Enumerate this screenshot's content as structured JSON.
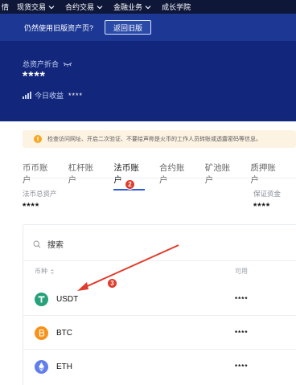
{
  "topnav": {
    "items": [
      {
        "label": "情",
        "has_chevron": false
      },
      {
        "label": "现货交易",
        "has_chevron": true
      },
      {
        "label": "合约交易",
        "has_chevron": true
      },
      {
        "label": "金融业务",
        "has_chevron": true
      },
      {
        "label": "成长学院",
        "has_chevron": false
      }
    ]
  },
  "old_bar": {
    "question": "仍然使用旧版资产页?",
    "button_label": "返回旧版"
  },
  "summary": {
    "total_label": "总资产折合",
    "total_value": "****",
    "today_label": "今日收益",
    "today_value": "****"
  },
  "notice": {
    "text": "检查访问网址、开启二次验证、不要给声称是火币的工作人员转账或透露密码等信息。"
  },
  "tabs": [
    {
      "label": "币币账户",
      "active": false
    },
    {
      "label": "杠杆账户",
      "active": false
    },
    {
      "label": "法币账户",
      "active": true
    },
    {
      "label": "合约账户",
      "active": false
    },
    {
      "label": "矿池账户",
      "active": false
    },
    {
      "label": "质押账户",
      "active": false
    }
  ],
  "fiat": {
    "label": "法币总资产",
    "value": "****",
    "margin_label": "保证资金",
    "margin_value": "****"
  },
  "search": {
    "placeholder": "搜索"
  },
  "table": {
    "col_currency": "币种",
    "col_available": "可用",
    "rows": [
      {
        "symbol": "USDT",
        "available": "****",
        "icon": "tether-icon",
        "color": "#26a17b"
      },
      {
        "symbol": "BTC",
        "available": "****",
        "icon": "bitcoin-icon",
        "color": "#f7931a"
      },
      {
        "symbol": "ETH",
        "available": "****",
        "icon": "ethereum-icon",
        "color": "#627eea"
      }
    ]
  },
  "annotations": [
    "2",
    "3"
  ],
  "colors": {
    "nav_bg": "#0e1738",
    "header_bg": "#12277b",
    "accent": "#2f5bd8",
    "badge": "#e03c2c",
    "arrow": "#e03c2c"
  }
}
